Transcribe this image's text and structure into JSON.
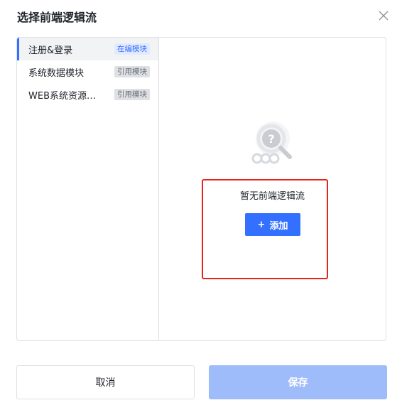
{
  "dialog": {
    "title": "选择前端逻辑流",
    "close_icon": "close-icon"
  },
  "sidebar": {
    "items": [
      {
        "label": "注册&登录",
        "badge": "在编模块",
        "active": true
      },
      {
        "label": "系统数据模块",
        "badge": "引用模块",
        "active": false
      },
      {
        "label": "WEB系统资源…",
        "badge": "引用模块",
        "active": false
      }
    ]
  },
  "empty_state": {
    "icon": "search-question-icon",
    "text": "暂无前端逻辑流",
    "add_button": {
      "icon": "plus",
      "label": "添加"
    }
  },
  "footer": {
    "cancel_label": "取消",
    "save_label": "保存"
  },
  "colors": {
    "accent": "#3370ff",
    "save_disabled": "#9fbcfa",
    "highlight_border": "#e5251c"
  }
}
